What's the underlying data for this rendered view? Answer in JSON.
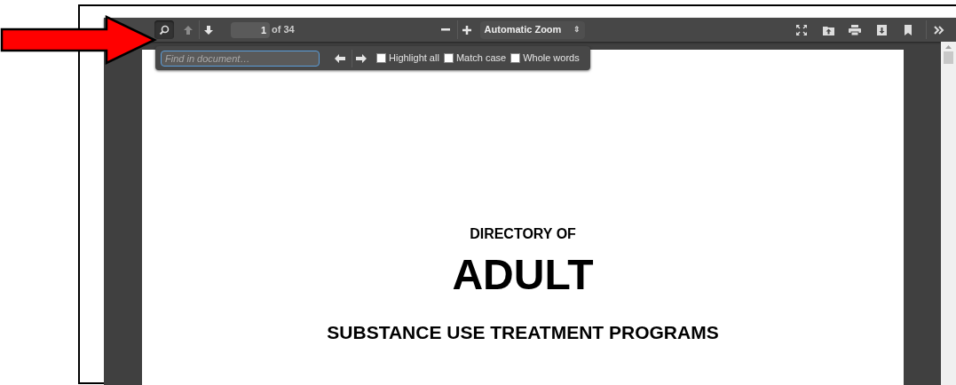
{
  "toolbar": {
    "page_number": "1",
    "page_count": "of 34",
    "zoom": "Automatic Zoom",
    "zoom_arrows": "⇕",
    "search_selected": true
  },
  "find_bar": {
    "placeholder": "Find in document…",
    "options": [
      {
        "label": "Highlight all",
        "checked": false
      },
      {
        "label": "Match case",
        "checked": false
      },
      {
        "label": "Whole words",
        "checked": false
      }
    ]
  },
  "document": {
    "lines": [
      {
        "kind": "subtitle",
        "text": "DIRECTORY OF"
      },
      {
        "kind": "title",
        "text": "ADULT"
      },
      {
        "kind": "heading",
        "text": "SUBSTANCE USE TREATMENT PROGRAMS"
      }
    ]
  }
}
